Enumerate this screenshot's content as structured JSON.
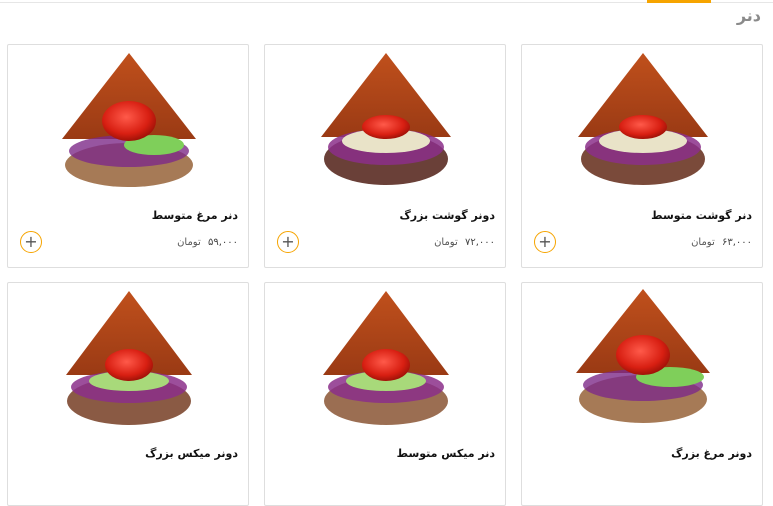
{
  "section": {
    "title": "دنر"
  },
  "currency": "تومان",
  "products": [
    {
      "name": "دنر گوشت متوسط",
      "price": "۶۳,۰۰۰",
      "add_icon": "plus-icon"
    },
    {
      "name": "دونر گوشت بزرگ",
      "price": "۷۲,۰۰۰",
      "add_icon": "plus-icon"
    },
    {
      "name": "دنر مرغ متوسط",
      "price": "۵۹,۰۰۰",
      "add_icon": "plus-icon"
    },
    {
      "name": "دونر مرغ بزرگ"
    },
    {
      "name": "دنر میکس متوسط"
    },
    {
      "name": "دونر میکس بزرگ"
    }
  ],
  "colors": {
    "accent": "#f6a400",
    "border": "#dedede",
    "title": "#8a8a8a"
  }
}
